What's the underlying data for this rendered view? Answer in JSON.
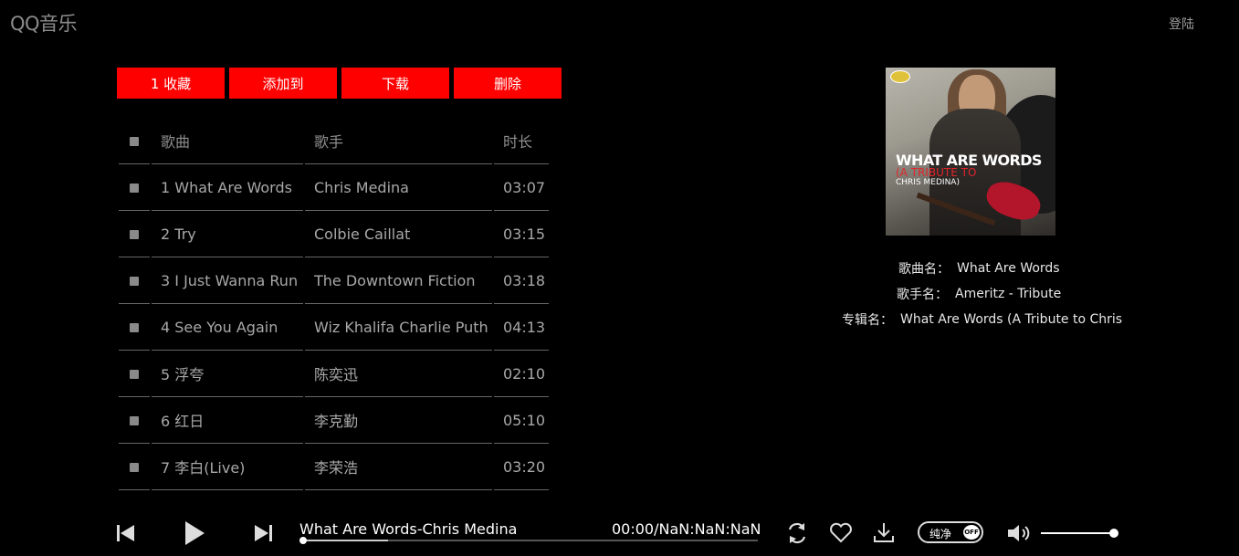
{
  "app": {
    "logo": "QQ音乐",
    "login_label": "登陆"
  },
  "toolbar": {
    "favorite": "1 收藏",
    "add_to": "添加到",
    "download": "下载",
    "delete": "删除"
  },
  "table": {
    "headers": {
      "song": "歌曲",
      "singer": "歌手",
      "duration": "时长"
    },
    "rows": [
      {
        "song": "1 What Are Words",
        "singer": "Chris Medina",
        "duration": "03:07"
      },
      {
        "song": "2 Try",
        "singer": "Colbie Caillat",
        "duration": "03:15"
      },
      {
        "song": "3 I Just Wanna Run",
        "singer": "The Downtown Fiction",
        "duration": "03:18"
      },
      {
        "song": "4 See You Again",
        "singer": "Wiz Khalifa Charlie Puth",
        "duration": "04:13"
      },
      {
        "song": "5 浮夸",
        "singer": "陈奕迅",
        "duration": "02:10"
      },
      {
        "song": "6 红日",
        "singer": "李克勤",
        "duration": "05:10"
      },
      {
        "song": "7 李白(Live)",
        "singer": "李荣浩",
        "duration": "03:20"
      }
    ]
  },
  "album_cover": {
    "title": "WHAT ARE WORDS",
    "subtitle": "(A TRIBUTE TO",
    "artist": "CHRIS MEDINA)"
  },
  "now_playing_info": {
    "song_label": "歌曲名：",
    "song_value": "What Are Words",
    "singer_label": "歌手名：",
    "singer_value": "Ameritz - Tribute",
    "album_label": "专辑名：",
    "album_value": "What Are Words (A Tribute to Chris"
  },
  "player": {
    "title": "What Are Words-Chris Medina",
    "time": "00:00/NaN:NaN:NaN",
    "progress": 0,
    "buffered": 0.19,
    "pure_label": "纯净",
    "pure_switch": "OFF",
    "volume": 0.97
  },
  "colors": {
    "accent": "#ff0000",
    "background": "#000000"
  }
}
